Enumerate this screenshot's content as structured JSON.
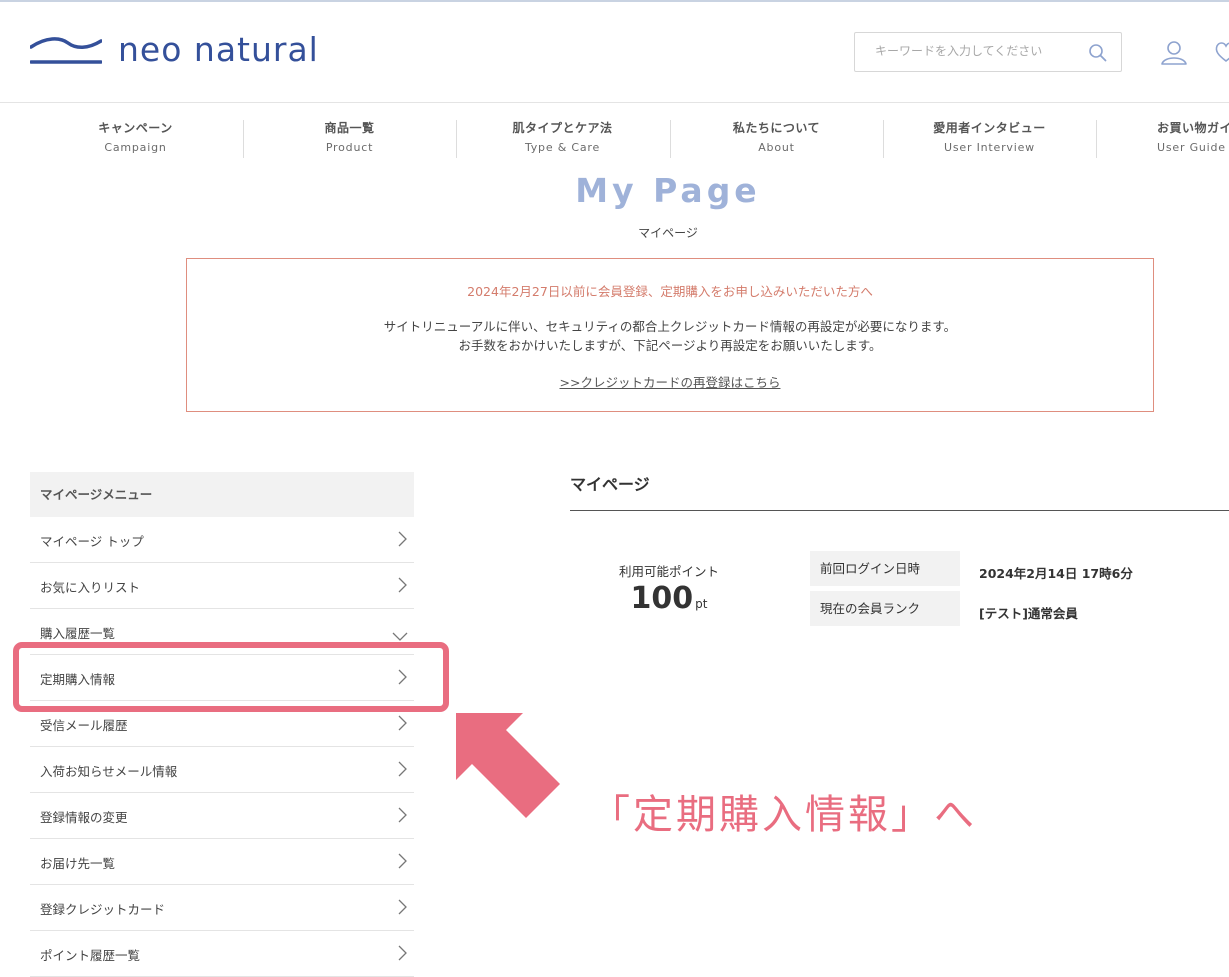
{
  "brand": {
    "name": "neo natural",
    "color": "#34509a"
  },
  "header": {
    "search_placeholder": "キーワードを入力してください",
    "icons": [
      "search-icon",
      "user-icon",
      "heart-icon"
    ]
  },
  "nav": [
    {
      "jp": "キャンペーン",
      "en": "Campaign"
    },
    {
      "jp": "商品一覧",
      "en": "Product"
    },
    {
      "jp": "肌タイプとケア法",
      "en": "Type & Care"
    },
    {
      "jp": "私たちについて",
      "en": "About"
    },
    {
      "jp": "愛用者インタビュー",
      "en": "User Interview"
    },
    {
      "jp": "お買い物ガイド",
      "en": "User Guide"
    }
  ],
  "page": {
    "title": "My Page",
    "subtitle": "マイページ"
  },
  "notice": {
    "title": "2024年2月27日以前に会員登録、定期購入をお申し込みいただいた方へ",
    "line1": "サイトリニューアルに伴い、セキュリティの都合上クレジットカード情報の再設定が必要になります。",
    "line2": "お手数をおかけいたしますが、下記ページより再設定をお願いいたします。",
    "link": ">>クレジットカードの再登録はこちら"
  },
  "sidebar": {
    "heading": "マイページメニュー",
    "items": [
      {
        "label": "マイページ トップ"
      },
      {
        "label": "お気に入りリスト"
      },
      {
        "label": "購入履歴一覧"
      },
      {
        "label": "定期購入情報"
      },
      {
        "label": "受信メール履歴"
      },
      {
        "label": "入荷お知らせメール情報"
      },
      {
        "label": "登録情報の変更"
      },
      {
        "label": "お届け先一覧"
      },
      {
        "label": "登録クレジットカード"
      },
      {
        "label": "ポイント履歴一覧"
      }
    ]
  },
  "main": {
    "title": "マイページ",
    "points_label": "利用可能ポイント",
    "points_value": "100",
    "points_unit": "pt",
    "last_login_label": "前回ログイン日時",
    "last_login_value": "2024年2月14日 17時6分",
    "rank_label": "現在の会員ランク",
    "rank_value": "[テスト]通常会員"
  },
  "annotation": {
    "text": "「定期購入情報」へ",
    "color": "#e96d80",
    "target": "定期購入情報"
  }
}
